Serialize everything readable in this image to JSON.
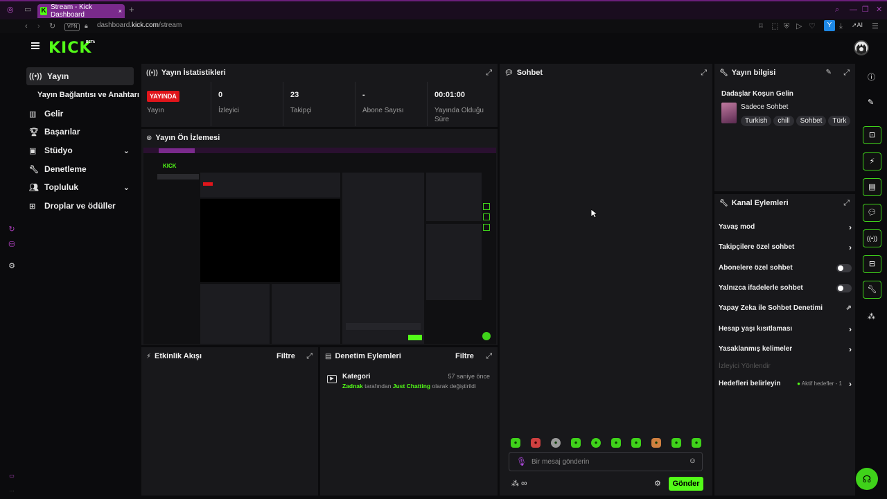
{
  "browser": {
    "tab_title": "Stream - Kick Dashboard",
    "vpn_label": "VPN",
    "url_domain": "dashboard.",
    "url_host": "kick.com",
    "url_path": "/stream",
    "ai_label": "AI",
    "profile_letter": "Y"
  },
  "app": {
    "logo": "KICK",
    "beta": "BETA"
  },
  "nav": {
    "items": [
      {
        "label": "Yayın",
        "icon": "broadcast-icon"
      },
      {
        "label": "Yayın Bağlantısı ve Anahtarı"
      },
      {
        "label": "Gelir",
        "icon": "chart-icon"
      },
      {
        "label": "Başarılar",
        "icon": "trophy-icon"
      },
      {
        "label": "Stüdyo",
        "icon": "studio-icon"
      },
      {
        "label": "Denetleme",
        "icon": "wrench-icon"
      },
      {
        "label": "Topluluk",
        "icon": "people-icon"
      },
      {
        "label": "Droplar ve ödüller",
        "icon": "gift-icon"
      }
    ]
  },
  "stats_panel": {
    "title": "Yayın İstatistikleri",
    "live_badge": "YAYINDA",
    "stats": [
      {
        "label": "Yayın"
      },
      {
        "value": "0",
        "label": "İzleyici"
      },
      {
        "value": "23",
        "label": "Takipçi"
      },
      {
        "value": "-",
        "label": "Abone Sayısı"
      },
      {
        "value": "00:01:00",
        "label": "Yayında Olduğu Süre"
      }
    ]
  },
  "preview_panel": {
    "title": "Yayın Ön İzlemesi"
  },
  "activity_panel": {
    "title": "Etkinlik Akışı",
    "filter": "Filtre"
  },
  "moderation_panel": {
    "title": "Denetim Eylemleri",
    "filter": "Filtre",
    "entry": {
      "title": "Kategori",
      "time": "57 saniye önce",
      "user": "Zadnak",
      "text1": "tarafından",
      "category": "Just Chatting",
      "text2": "olarak değiştirildi"
    }
  },
  "chat_panel": {
    "title": "Sohbet",
    "input_placeholder": "Bir mesaj gönderin",
    "send": "Gönder"
  },
  "stream_info": {
    "title": "Yayın bilgisi",
    "stream_title": "Dadaşlar Koşun Gelin",
    "category": "Sadece Sohbet",
    "tags": [
      "Turkish",
      "chill",
      "Sohbet",
      "Türk"
    ]
  },
  "channel_actions": {
    "title": "Kanal Eylemleri",
    "items": [
      {
        "label": "Yavaş mod"
      },
      {
        "label": "Takipçilere özel sohbet"
      },
      {
        "label": "Abonelere özel sohbet"
      },
      {
        "label": "Yalnızca ifadelerle sohbet"
      },
      {
        "label": "Yapay Zeka ile Sohbet Denetimi"
      },
      {
        "label": "Hesap yaşı kısıtlaması"
      },
      {
        "label": "Yasaklanmış kelimeler"
      },
      {
        "label": "İzleyici Yönlendir"
      },
      {
        "label": "Hedefleri belirleyin"
      }
    ],
    "goals_status": "Aktif hedefler - 1"
  },
  "colors": {
    "accent": "#53fc18",
    "live": "#e0151b",
    "panel": "#18181b",
    "background": "#0b0b0d"
  }
}
